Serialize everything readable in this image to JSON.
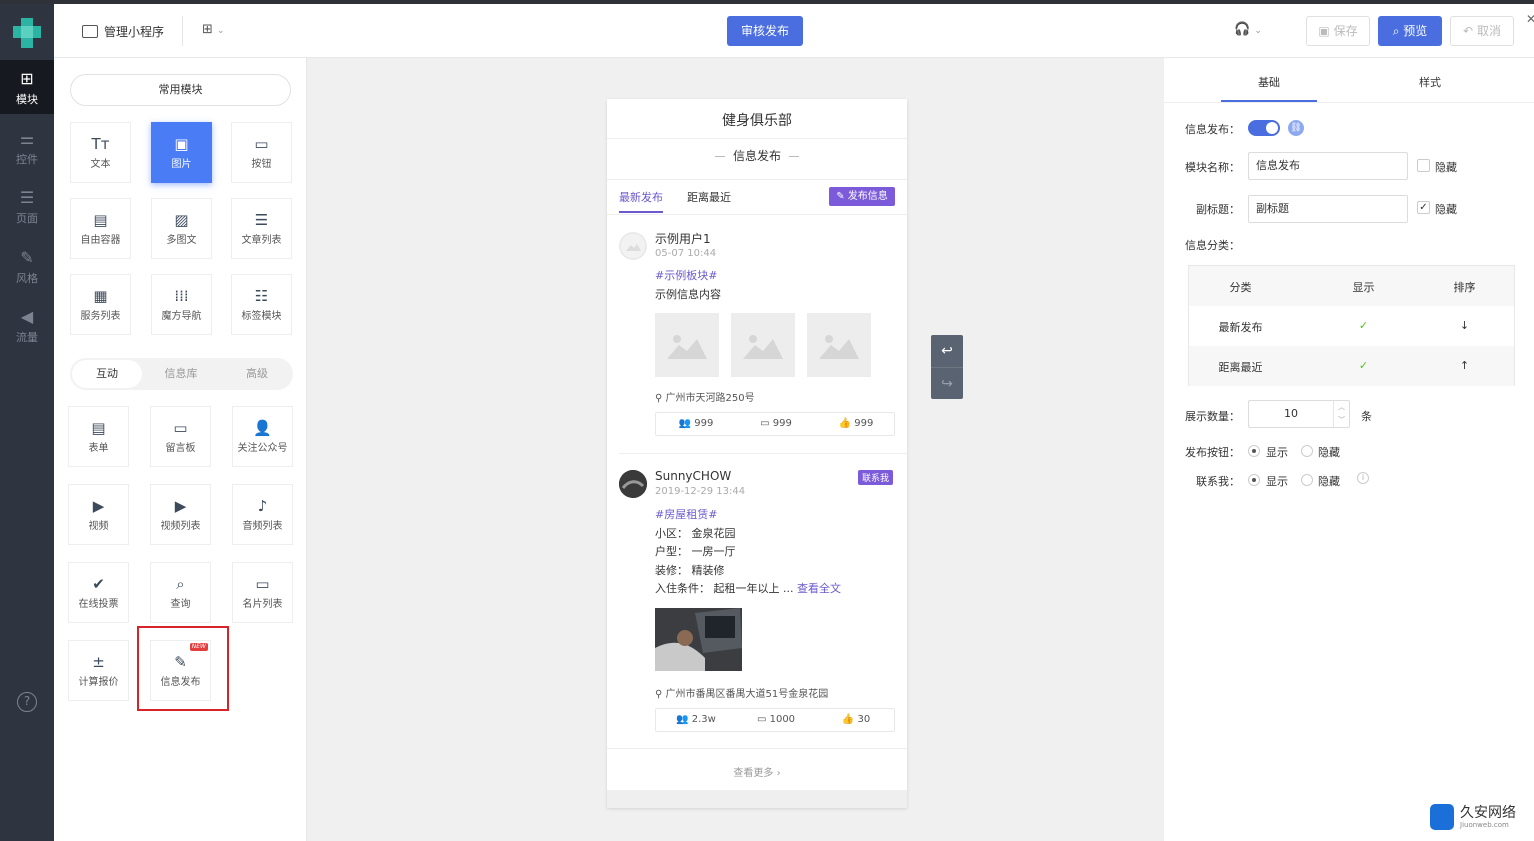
{
  "leftnav": {
    "items": [
      {
        "label": "模块",
        "icon": "plus-square-icon"
      },
      {
        "label": "控件",
        "icon": "sliders-icon"
      },
      {
        "label": "页面",
        "icon": "page-icon"
      },
      {
        "label": "风格",
        "icon": "brush-icon"
      },
      {
        "label": "流量",
        "icon": "megaphone-icon"
      }
    ],
    "help": "?"
  },
  "topbar": {
    "app_label": "管理小程序",
    "grid_arrow": "⌄",
    "review_button": "审核发布",
    "save_button": "保存",
    "preview_button": "预览",
    "cancel_button": "取消"
  },
  "modules": {
    "common_title": "常用模块",
    "common": [
      {
        "label": "文本",
        "icon": "Tт"
      },
      {
        "label": "图片",
        "icon": "▣"
      },
      {
        "label": "按钮",
        "icon": "▭"
      },
      {
        "label": "自由容器",
        "icon": "▤"
      },
      {
        "label": "多图文",
        "icon": "▨"
      },
      {
        "label": "文章列表",
        "icon": "☰"
      },
      {
        "label": "服务列表",
        "icon": "▦"
      },
      {
        "label": "魔方导航",
        "icon": "⁞⁞⁞"
      },
      {
        "label": "标签模块",
        "icon": "☷"
      }
    ],
    "tabs": [
      "互动",
      "信息库",
      "高级"
    ],
    "interactive": [
      {
        "label": "表单",
        "icon": "▤"
      },
      {
        "label": "留言板",
        "icon": "▭"
      },
      {
        "label": "关注公众号",
        "icon": "👤"
      },
      {
        "label": "视频",
        "icon": "▶"
      },
      {
        "label": "视频列表",
        "icon": "▶"
      },
      {
        "label": "音频列表",
        "icon": "♪"
      },
      {
        "label": "在线投票",
        "icon": "✔"
      },
      {
        "label": "查询",
        "icon": "⌕"
      },
      {
        "label": "名片列表",
        "icon": "▭"
      },
      {
        "label": "计算报价",
        "icon": "±"
      },
      {
        "label": "信息发布",
        "icon": "✎"
      }
    ],
    "new_badge": "NEW"
  },
  "phone": {
    "title": "健身俱乐部",
    "subtitle": "信息发布",
    "tab_latest": "最新发布",
    "tab_nearest": "距离最近",
    "publish_button": "发布信息",
    "posts": [
      {
        "user": "示例用户1",
        "time": "05-07 10:44",
        "tag": "#示例板块#",
        "lines": [
          "示例信息内容"
        ],
        "location": "广州市天河路250号",
        "stats": [
          "999",
          "999",
          "999"
        ]
      },
      {
        "user": "SunnyCHOW",
        "time": "2019-12-29 13:44",
        "tag": "#房屋租赁#",
        "lines": [
          "小区： 金泉花园",
          "户型： 一房一厅",
          "装修： 精装修",
          "入住条件： 起租一年以上 ..."
        ],
        "read_more": "查看全文",
        "contact": "联系我",
        "location": "广州市番禺区番禺大道51号金泉花园",
        "stats": [
          "2.3w",
          "1000",
          "30"
        ]
      }
    ],
    "more": "查看更多 ›"
  },
  "settings": {
    "tab_basic": "基础",
    "tab_style": "样式",
    "info_publish_label": "信息发布：",
    "module_name_label": "模块名称：",
    "module_name_value": "信息发布",
    "hide_label": "隐藏",
    "subtitle_label": "副标题：",
    "subtitle_value": "副标题",
    "category_label": "信息分类：",
    "table_headers": [
      "分类",
      "显示",
      "排序"
    ],
    "table_rows": [
      {
        "name": "最新发布",
        "show": "✓",
        "sort": "↓"
      },
      {
        "name": "距离最近",
        "show": "✓",
        "sort": "↑"
      }
    ],
    "count_label": "展示数量：",
    "count_value": "10",
    "count_unit": "条",
    "publish_btn_label": "发布按钮：",
    "contact_label": "联系我：",
    "show_option": "显示",
    "hide_option": "隐藏"
  },
  "watermark": {
    "title": "久安网络",
    "sub": "Jiuonweb.com"
  }
}
